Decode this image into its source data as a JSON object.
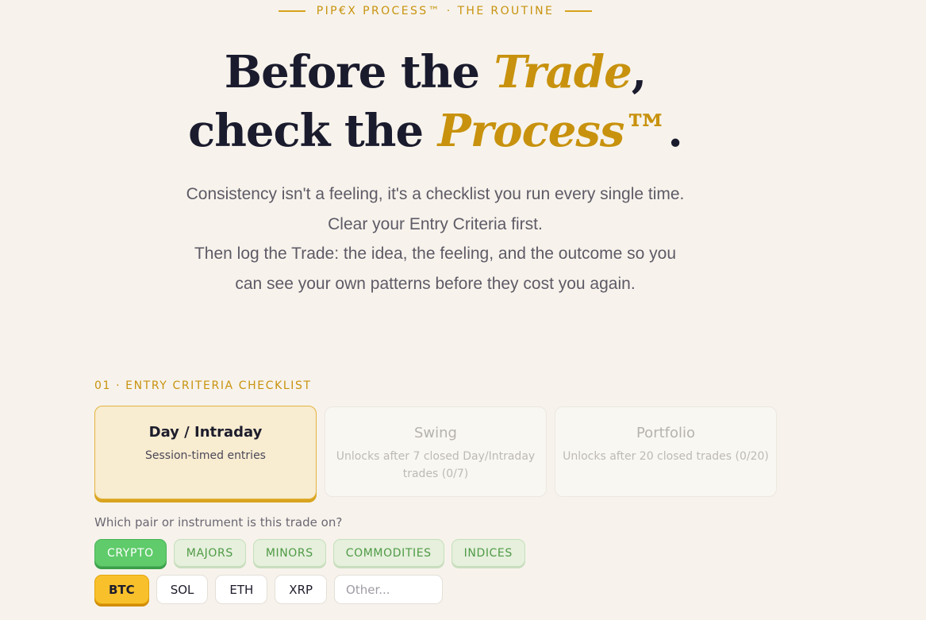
{
  "eyebrow": "PIP€X PROCESS™ · THE ROUTINE",
  "headline": {
    "line1_pre": "Before the ",
    "line1_accent": "Trade",
    "line1_post": ",",
    "line2_pre": "check the ",
    "line2_accent": "Process™",
    "line2_post": "."
  },
  "lede": [
    "Consistency isn't a feeling, it's a checklist you run every single time.",
    "Clear your Entry Criteria first.",
    "Then log the Trade: the idea, the feeling, and the outcome so you",
    "can see your own patterns before they cost you again."
  ],
  "section_label": "01 · ENTRY CRITERIA CHECKLIST",
  "tiers": [
    {
      "title": "Day / Intraday",
      "subtitle": "Session-timed entries",
      "active": true,
      "locked": false
    },
    {
      "title": "Swing",
      "subtitle": "Unlocks after 7 closed Day/Intraday trades (0/7)",
      "active": false,
      "locked": true
    },
    {
      "title": "Portfolio",
      "subtitle": "Unlocks after 20 closed trades (0/20)",
      "active": false,
      "locked": true
    }
  ],
  "question": "Which pair or instrument is this trade on?",
  "categories": [
    "CRYPTO",
    "MAJORS",
    "MINORS",
    "COMMODITIES",
    "INDICES"
  ],
  "selected_category": "CRYPTO",
  "assets": [
    "BTC",
    "SOL",
    "ETH",
    "XRP"
  ],
  "selected_asset": "BTC",
  "other_placeholder": "Other...",
  "colors": {
    "background": "#f7f3ec",
    "accent_gold": "#c8920e",
    "category_active": "#5fcb6a",
    "asset_active": "#f8c12b"
  }
}
